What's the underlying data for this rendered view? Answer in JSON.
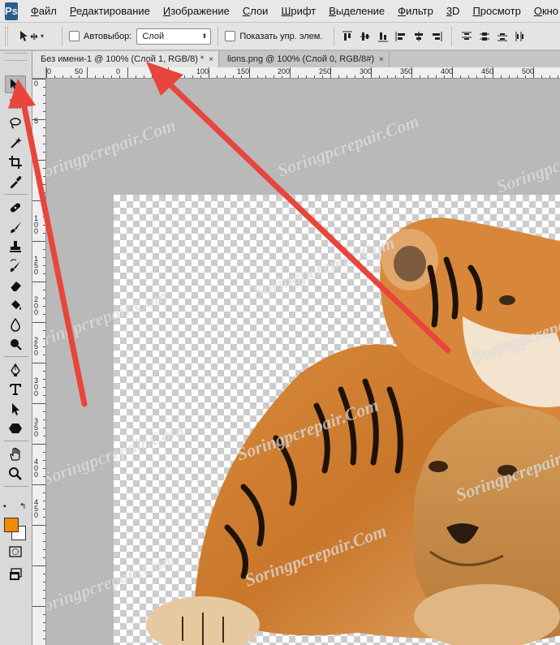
{
  "app": {
    "logo": "Ps",
    "menu": [
      "Файл",
      "Редактирование",
      "Изображение",
      "Слои",
      "Шрифт",
      "Выделение",
      "Фильтр",
      "3D",
      "Просмотр",
      "Окно"
    ]
  },
  "options": {
    "autoselect_label": "Автовыбор:",
    "autoselect_value": "Слой",
    "show_controls_label": "Показать упр. элем."
  },
  "tabs": [
    {
      "label": "Без имени-1 @ 100% (Слой 1, RGB/8) *",
      "close": "×"
    },
    {
      "label": "lions.png @ 100% (Слой 0, RGB/8#)",
      "close": "×"
    }
  ],
  "ruler": {
    "h_labels": [
      "0",
      "50",
      "0",
      "50",
      "100",
      "150",
      "200",
      "250",
      "300",
      "350",
      "400",
      "450",
      "500"
    ],
    "v_labels": [
      "0",
      "5",
      "1 0 0",
      "1 5 0",
      "2 0 0",
      "2 5 0",
      "3 0 0",
      "3 5 0",
      "4 0 0",
      "4 5 0"
    ]
  },
  "toolbox": {
    "foreground_color": "#f08a00",
    "background_color": "#ffffff",
    "tools": [
      "move-tool-icon",
      "marquee-tool-icon",
      "lasso-tool-icon",
      "magic-wand-icon",
      "crop-tool-icon",
      "eyedropper-icon",
      "healing-brush-icon",
      "brush-tool-icon",
      "clone-stamp-icon",
      "history-brush-icon",
      "eraser-icon",
      "paint-bucket-icon",
      "blur-tool-icon",
      "dodge-tool-icon",
      "pen-tool-icon",
      "type-tool-icon",
      "path-selection-icon",
      "shape-tool-icon",
      "hand-tool-icon",
      "zoom-tool-icon",
      "quick-mask-icon",
      "screen-mode-icon"
    ]
  },
  "watermark": "Soringpcrepair.Com",
  "colors": {
    "arrow": "#e8453c",
    "workspace": "#b9b9b9",
    "menubar": "#e8e8e8"
  }
}
